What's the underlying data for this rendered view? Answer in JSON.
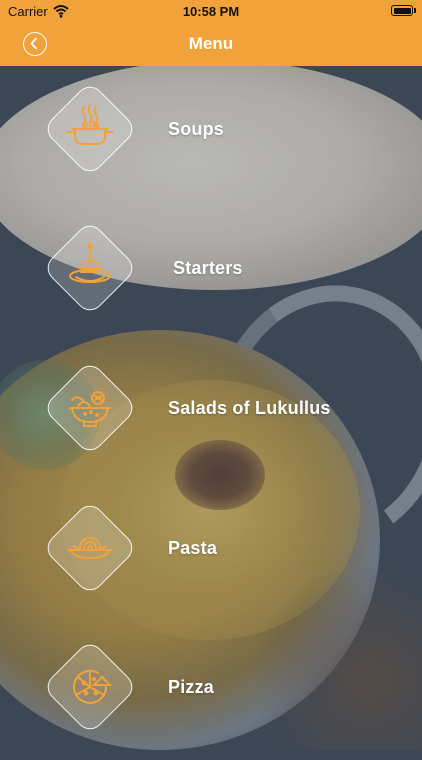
{
  "status_bar": {
    "carrier": "Carrier",
    "time": "10:58 PM"
  },
  "nav": {
    "title": "Menu",
    "back_icon": "chevron-left-circle-icon"
  },
  "menu": {
    "items": [
      {
        "label": "Soups",
        "icon": "soup-pot-icon"
      },
      {
        "label": "Starters",
        "icon": "starter-plate-icon"
      },
      {
        "label": "Salads of Lukullus",
        "icon": "salad-bowl-icon"
      },
      {
        "label": "Pasta",
        "icon": "pasta-plate-icon"
      },
      {
        "label": "Pizza",
        "icon": "pizza-icon"
      }
    ]
  },
  "colors": {
    "accent": "#f2a23a",
    "icon_stroke": "#f2a23a",
    "text": "#ffffff"
  }
}
